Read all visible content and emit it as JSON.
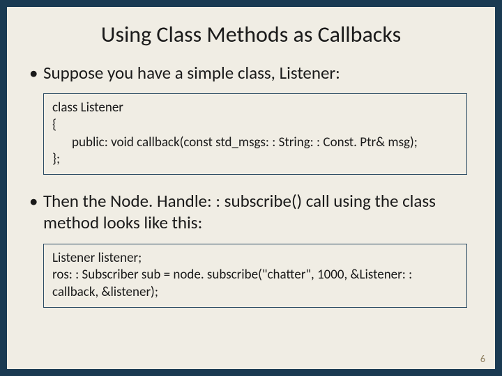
{
  "title": "Using Class Methods as Callbacks",
  "bullet1": "Suppose you have a simple class, Listener:",
  "code1": {
    "l1": "class Listener",
    "l2": "{",
    "l3": "public: void callback(const std_msgs: : String: : Const. Ptr& msg);",
    "l4": "};"
  },
  "bullet2": "Then the Node. Handle: : subscribe() call using the class method looks like this:",
  "code2": {
    "l1": "Listener listener;",
    "l2": "ros: : Subscriber sub = node. subscribe(\"chatter\", 1000, &Listener: : callback, &listener);"
  },
  "pageNumber": "6"
}
